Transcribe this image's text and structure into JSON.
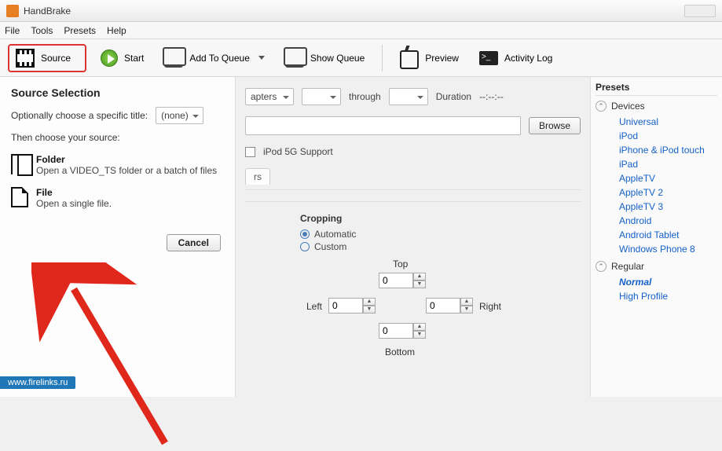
{
  "title": "HandBrake",
  "menubar": [
    "File",
    "Tools",
    "Presets",
    "Help"
  ],
  "toolbar": {
    "source": "Source",
    "start": "Start",
    "add_queue": "Add To Queue",
    "show_queue": "Show Queue",
    "preview": "Preview",
    "activity_log": "Activity Log"
  },
  "source_panel": {
    "heading": "Source Selection",
    "opt_label": "Optionally choose a specific title:",
    "opt_value": "(none)",
    "then_label": "Then choose your source:",
    "folder_title": "Folder",
    "folder_desc": "Open a VIDEO_TS folder or a batch of files",
    "file_title": "File",
    "file_desc": "Open a single file.",
    "cancel": "Cancel"
  },
  "main": {
    "chapters": "apters",
    "through": "through",
    "duration": "Duration",
    "duration_val": "--:--:--",
    "browse": "Browse",
    "ipod": "iPod 5G Support",
    "cropping": "Cropping",
    "auto": "Automatic",
    "custom": "Custom",
    "top": "Top",
    "bottom": "Bottom",
    "left": "Left",
    "right": "Right",
    "crop_val": "0"
  },
  "presets": {
    "header": "Presets",
    "devices": "Devices",
    "regular": "Regular",
    "device_items": [
      "Universal",
      "iPod",
      "iPhone & iPod touch",
      "iPad",
      "AppleTV",
      "AppleTV 2",
      "AppleTV 3",
      "Android",
      "Android Tablet",
      "Windows Phone 8"
    ],
    "regular_items": [
      "Normal",
      "High Profile"
    ]
  },
  "watermark": "www.firelinks.ru"
}
